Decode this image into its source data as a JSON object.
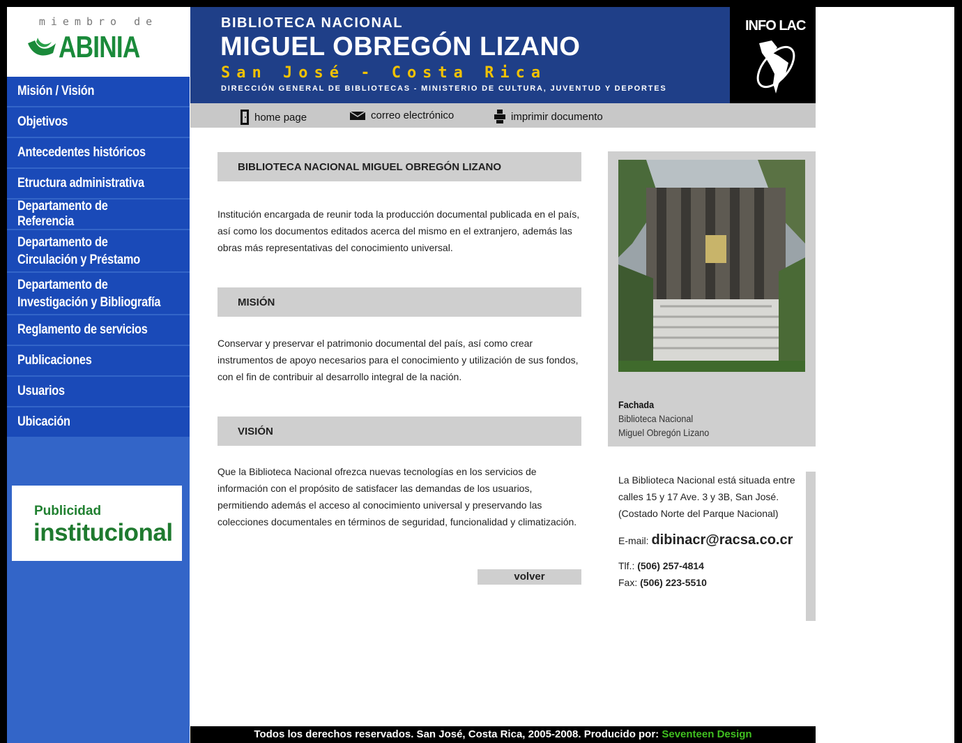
{
  "sidebar": {
    "abinia_top": "miembro de",
    "abinia_name": "ABINIA",
    "items": [
      {
        "label": "Misión / Visión"
      },
      {
        "label": "Objetivos"
      },
      {
        "label": "Antecedentes históricos"
      },
      {
        "label": "Etructura administrativa"
      },
      {
        "label": "Departamento de Referencia"
      },
      {
        "label": "Departamento de\nCirculación y Préstamo"
      },
      {
        "label": "Departamento de\nInvestigación y Bibliografía"
      },
      {
        "label": "Reglamento de servicios"
      },
      {
        "label": "Publicaciones"
      },
      {
        "label": "Usuarios"
      },
      {
        "label": "Ubicación"
      }
    ],
    "promo_line1": "Publicidad",
    "promo_line2": "institucional"
  },
  "header": {
    "line1": "BIBLIOTECA NACIONAL",
    "line2": "MIGUEL OBREGÓN LIZANO",
    "line3": "San José - Costa Rica",
    "line4": "DIRECCIÓN GENERAL DE BIBLIOTECAS - MINISTERIO DE CULTURA, JUVENTUD Y DEPORTES",
    "infolac": "INFO LAC"
  },
  "toolbar": {
    "home": "home page",
    "email": "correo electrónico",
    "print": "imprimir documento"
  },
  "main": {
    "title1": "BIBLIOTECA NACIONAL MIGUEL OBREGÓN LIZANO",
    "text1": "Institución encargada de reunir toda la producción documental publicada en el país, así como los documentos editados acerca del mismo en el extranjero, además las obras más representativas del conocimiento universal.",
    "title2": "MISIÓN",
    "text2": "Conservar y preservar el patrimonio documental del país, así como crear instrumentos de apoyo necesarios para el conocimiento y utilización de sus fondos, con el fin de contribuir al desarrollo integral de la nación.",
    "title3": "VISIÓN",
    "text3": "Que la Biblioteca Nacional ofrezca nuevas tecnologías en los servicios de información con el propósito de satisfacer las demandas de los usuarios, permitiendo además el acceso al conocimiento universal y preservando las colecciones documentales en términos de seguridad, funcionalidad y climatización.",
    "volver": "volver"
  },
  "photo": {
    "cap1": "Fachada",
    "cap2": "Biblioteca Nacional",
    "cap3": "Miguel Obregón Lizano"
  },
  "contact": {
    "address": "La Biblioteca Nacional está situada entre calles 15 y 17 Ave. 3 y 3B, San José. (Costado Norte del Parque Nacional)",
    "email_label": "E-mail:",
    "email": "dibinacr@racsa.co.cr",
    "tel_label": "Tlf.:",
    "tel": "(506) 257-4814",
    "fax_label": "Fax:",
    "fax": "(506) 223-5510"
  },
  "footer": {
    "text": "Todos los derechos reservados. San José, Costa Rica, 2005-2008. Producido por:",
    "credit": "Seventeen Design"
  },
  "colors": {
    "sidebar_bg": "#3365c8",
    "nav_item_bg": "#1a4ab8",
    "header_bg": "#1f3f88",
    "header_accent": "#f2c200",
    "panel_grey": "#cfcfcf",
    "footer_credit": "#40c020"
  }
}
